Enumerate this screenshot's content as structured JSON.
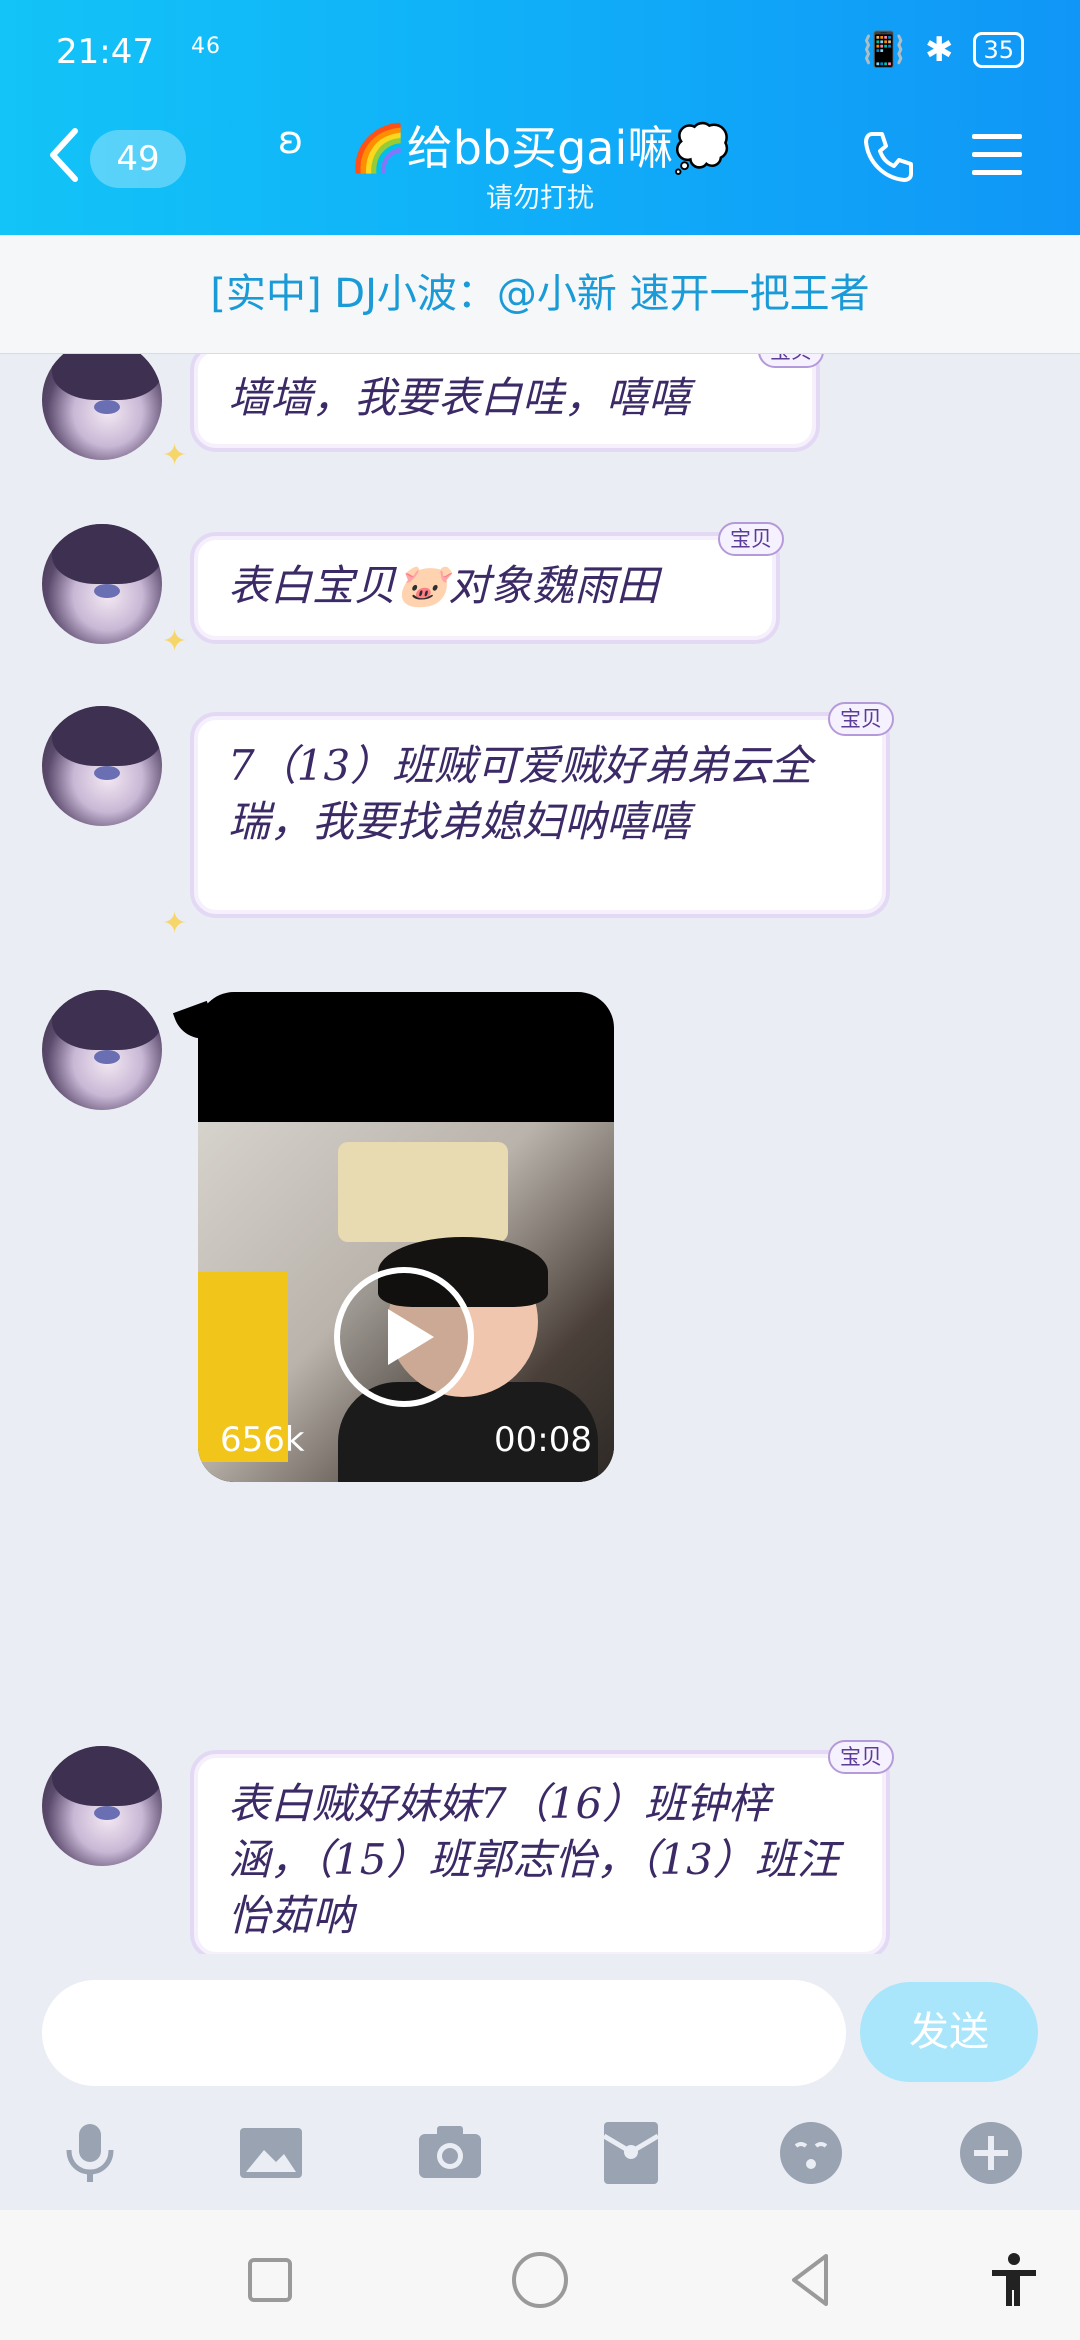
{
  "status": {
    "time": "21:47",
    "network": "46",
    "battery": "35"
  },
  "header": {
    "unread_count": "49",
    "title": "🌈给bb买gai嘛💭",
    "subtitle": "请勿打扰"
  },
  "notice": {
    "text": "[实中] DJ小波：@小新 速开一把王者"
  },
  "messages": [
    {
      "text": "墙墙，我要表白哇，嘻嘻",
      "tag": "宝贝"
    },
    {
      "text": "表白宝贝🐷对象魏雨田",
      "tag": "宝贝"
    },
    {
      "text": "7（13）班贼可爱贼好弟弟云全瑞，我要找弟媳妇呐嘻嘻",
      "tag": "宝贝"
    },
    {
      "type": "video",
      "size": "656k",
      "duration": "00:08"
    },
    {
      "text": "表白贼好妹妹7（16）班钟梓涵，（15）班郭志怡，（13）班汪怡茹呐",
      "tag": "宝贝"
    }
  ],
  "input": {
    "placeholder": "",
    "send_label": "发送"
  },
  "toolbar": [
    "microphone-icon",
    "image-icon",
    "camera-icon",
    "redpacket-icon",
    "emoji-icon",
    "plus-icon"
  ],
  "colors": {
    "header": "#10aef8",
    "notice_text": "#1a9bd7",
    "send_button": "#a9e6fb"
  }
}
